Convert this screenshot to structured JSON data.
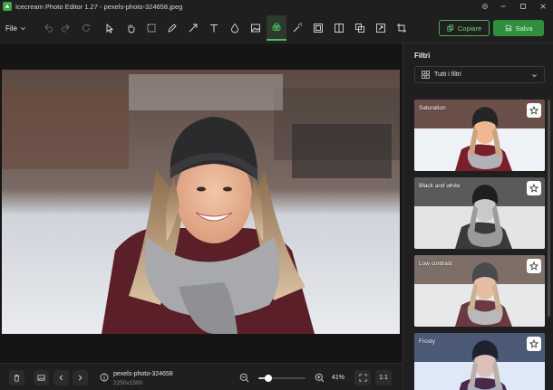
{
  "window": {
    "title": "Icecream Photo Editor 1.27 - pexels-photo-324658.jpeg",
    "controls": [
      "minimize-icon",
      "maximize-icon",
      "close-icon"
    ]
  },
  "toolbar": {
    "file_menu": "File",
    "copy_label": "Copiare",
    "save_label": "Salva",
    "tools": [
      "undo-icon",
      "redo-icon",
      "reset-icon",
      "select-icon",
      "hand-icon",
      "crop-select-icon",
      "pen-icon",
      "arrow-icon",
      "text-icon",
      "blur-drop-icon",
      "image-icon",
      "filters-icon",
      "magic-wand-icon",
      "picture-frame-icon",
      "split-icon",
      "layers-icon",
      "resize-icon",
      "crop-icon"
    ],
    "active_tool": "filters-icon"
  },
  "bottombar": {
    "file_name": "pexels-photo-324658",
    "dimensions": "2250x1500",
    "zoom_label": "41%",
    "zoom_value": 0.41,
    "one_to_one": "1:1"
  },
  "panel": {
    "title": "Filtri",
    "filter_dropdown": "Tutti i filtri",
    "filters": [
      {
        "name": "Saturation"
      },
      {
        "name": "Black and white"
      },
      {
        "name": "Low contrast"
      },
      {
        "name": "Frosty"
      }
    ]
  },
  "colors": {
    "accent": "#4caf50",
    "save_bg": "#2f8f3c",
    "panel_bg": "#1f1f1f",
    "canvas_bg": "#151515"
  }
}
